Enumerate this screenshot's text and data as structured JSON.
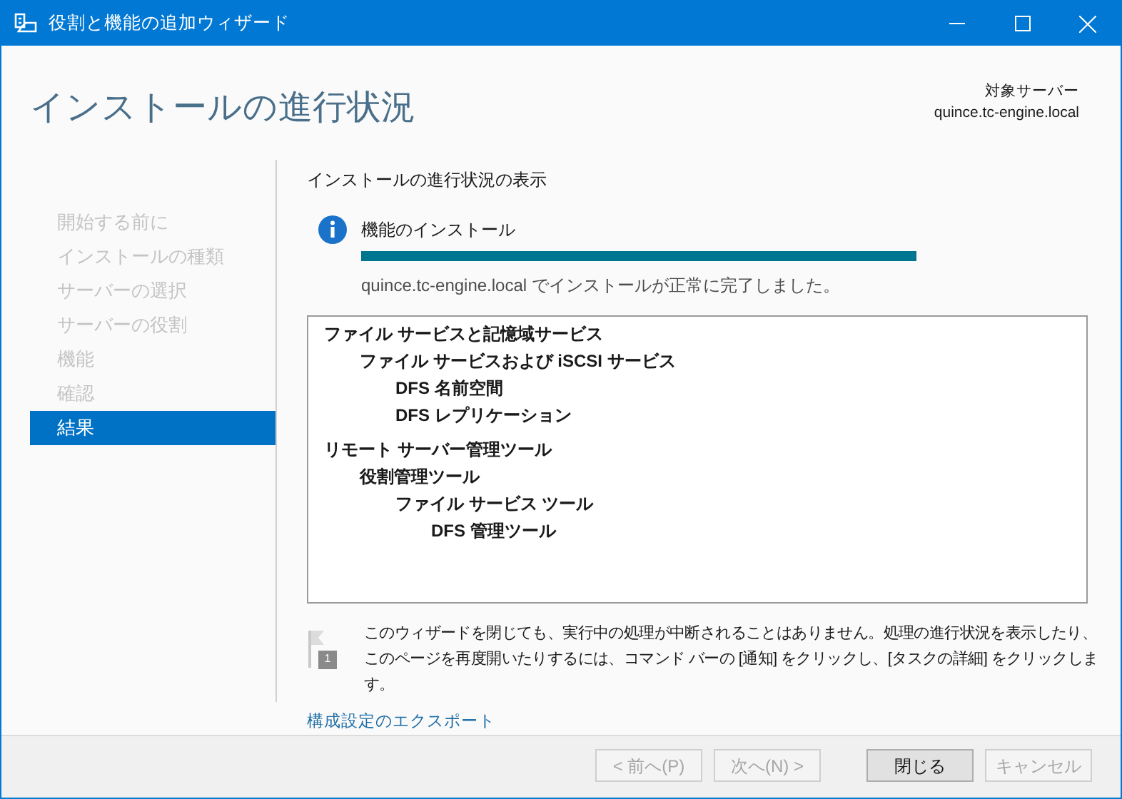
{
  "window": {
    "title": "役割と機能の追加ウィザード"
  },
  "header": {
    "title": "インストールの進行状況",
    "target_label": "対象サーバー",
    "target_server": "quince.tc-engine.local"
  },
  "sidebar": {
    "items": [
      {
        "label": "開始する前に",
        "selected": false
      },
      {
        "label": "インストールの種類",
        "selected": false
      },
      {
        "label": "サーバーの選択",
        "selected": false
      },
      {
        "label": "サーバーの役割",
        "selected": false
      },
      {
        "label": "機能",
        "selected": false
      },
      {
        "label": "確認",
        "selected": false
      },
      {
        "label": "結果",
        "selected": true
      }
    ]
  },
  "section_title": "インストールの進行状況の表示",
  "progress": {
    "label": "機能のインストール",
    "level": 1,
    "message": "quince.tc-engine.local でインストールが正常に完了しました。"
  },
  "results": [
    {
      "label": "ファイル サービスと記憶域サービス",
      "children": [
        {
          "label": "ファイル サービスおよび iSCSI サービス",
          "children": [
            {
              "label": "DFS 名前空間"
            },
            {
              "label": "DFS レプリケーション"
            }
          ]
        }
      ]
    },
    {
      "label": "リモート サーバー管理ツール",
      "children": [
        {
          "label": "役割管理ツール",
          "children": [
            {
              "label": "ファイル サービス ツール",
              "children": [
                {
                  "label": "DFS 管理ツール"
                }
              ]
            }
          ]
        }
      ]
    }
  ],
  "notice": {
    "badge": "1",
    "text": "このウィザードを閉じても、実行中の処理が中断されることはありません。処理の進行状況を表示したり、このページを再度開いたりするには、コマンド バーの [通知] をクリックし、[タスクの詳細] をクリックします。"
  },
  "export_link": "構成設定のエクスポート",
  "buttons": [
    {
      "label": "< 前へ(P)",
      "disabled": true
    },
    {
      "label": "次へ(N) >",
      "disabled": true
    },
    {
      "label": "閉じる",
      "disabled": false
    },
    {
      "label": "キャンセル",
      "disabled": true
    }
  ]
}
